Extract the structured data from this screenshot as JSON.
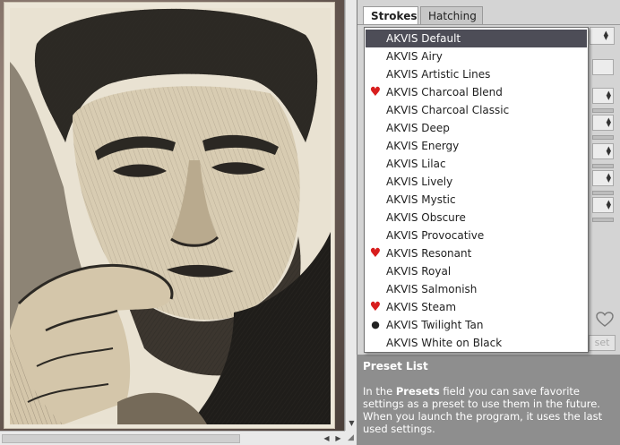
{
  "tabs": [
    {
      "label": "Strokes",
      "active": true
    },
    {
      "label": "Hatching",
      "active": false
    }
  ],
  "presets": [
    {
      "label": "AKVIS Default",
      "mark": "",
      "selected": true
    },
    {
      "label": "AKVIS Airy",
      "mark": "",
      "selected": false
    },
    {
      "label": "AKVIS Artistic Lines",
      "mark": "",
      "selected": false
    },
    {
      "label": "AKVIS Charcoal Blend",
      "mark": "heart",
      "selected": false
    },
    {
      "label": "AKVIS Charcoal Classic",
      "mark": "",
      "selected": false
    },
    {
      "label": "AKVIS Deep",
      "mark": "",
      "selected": false
    },
    {
      "label": "AKVIS Energy",
      "mark": "",
      "selected": false
    },
    {
      "label": "AKVIS Lilac",
      "mark": "",
      "selected": false
    },
    {
      "label": "AKVIS Lively",
      "mark": "",
      "selected": false
    },
    {
      "label": "AKVIS Mystic",
      "mark": "",
      "selected": false
    },
    {
      "label": "AKVIS Obscure",
      "mark": "",
      "selected": false
    },
    {
      "label": "AKVIS Provocative",
      "mark": "",
      "selected": false
    },
    {
      "label": "AKVIS Resonant",
      "mark": "heart",
      "selected": false
    },
    {
      "label": "AKVIS Royal",
      "mark": "",
      "selected": false
    },
    {
      "label": "AKVIS Salmonish",
      "mark": "",
      "selected": false
    },
    {
      "label": "AKVIS Steam",
      "mark": "heart",
      "selected": false
    },
    {
      "label": "AKVIS Twilight Tan",
      "mark": "dot",
      "selected": false
    },
    {
      "label": "AKVIS White on Black",
      "mark": "",
      "selected": false
    }
  ],
  "reset_fragment": "set",
  "help": {
    "title": "Preset List",
    "text_before": "In the ",
    "text_bold": "Presets",
    "text_after": " field you can save favorite settings as a preset to use them in the future. When you launch the program, it uses the last used settings."
  },
  "icons": {
    "favorite": "heart-icon",
    "current": "dot-icon",
    "favorite_toggle": "heart-outline-icon"
  },
  "colors": {
    "selected_bg": "#4d4d57",
    "heart": "#d81e1e",
    "panel": "#d4d4d4",
    "help_bg": "#8e8e8e"
  }
}
